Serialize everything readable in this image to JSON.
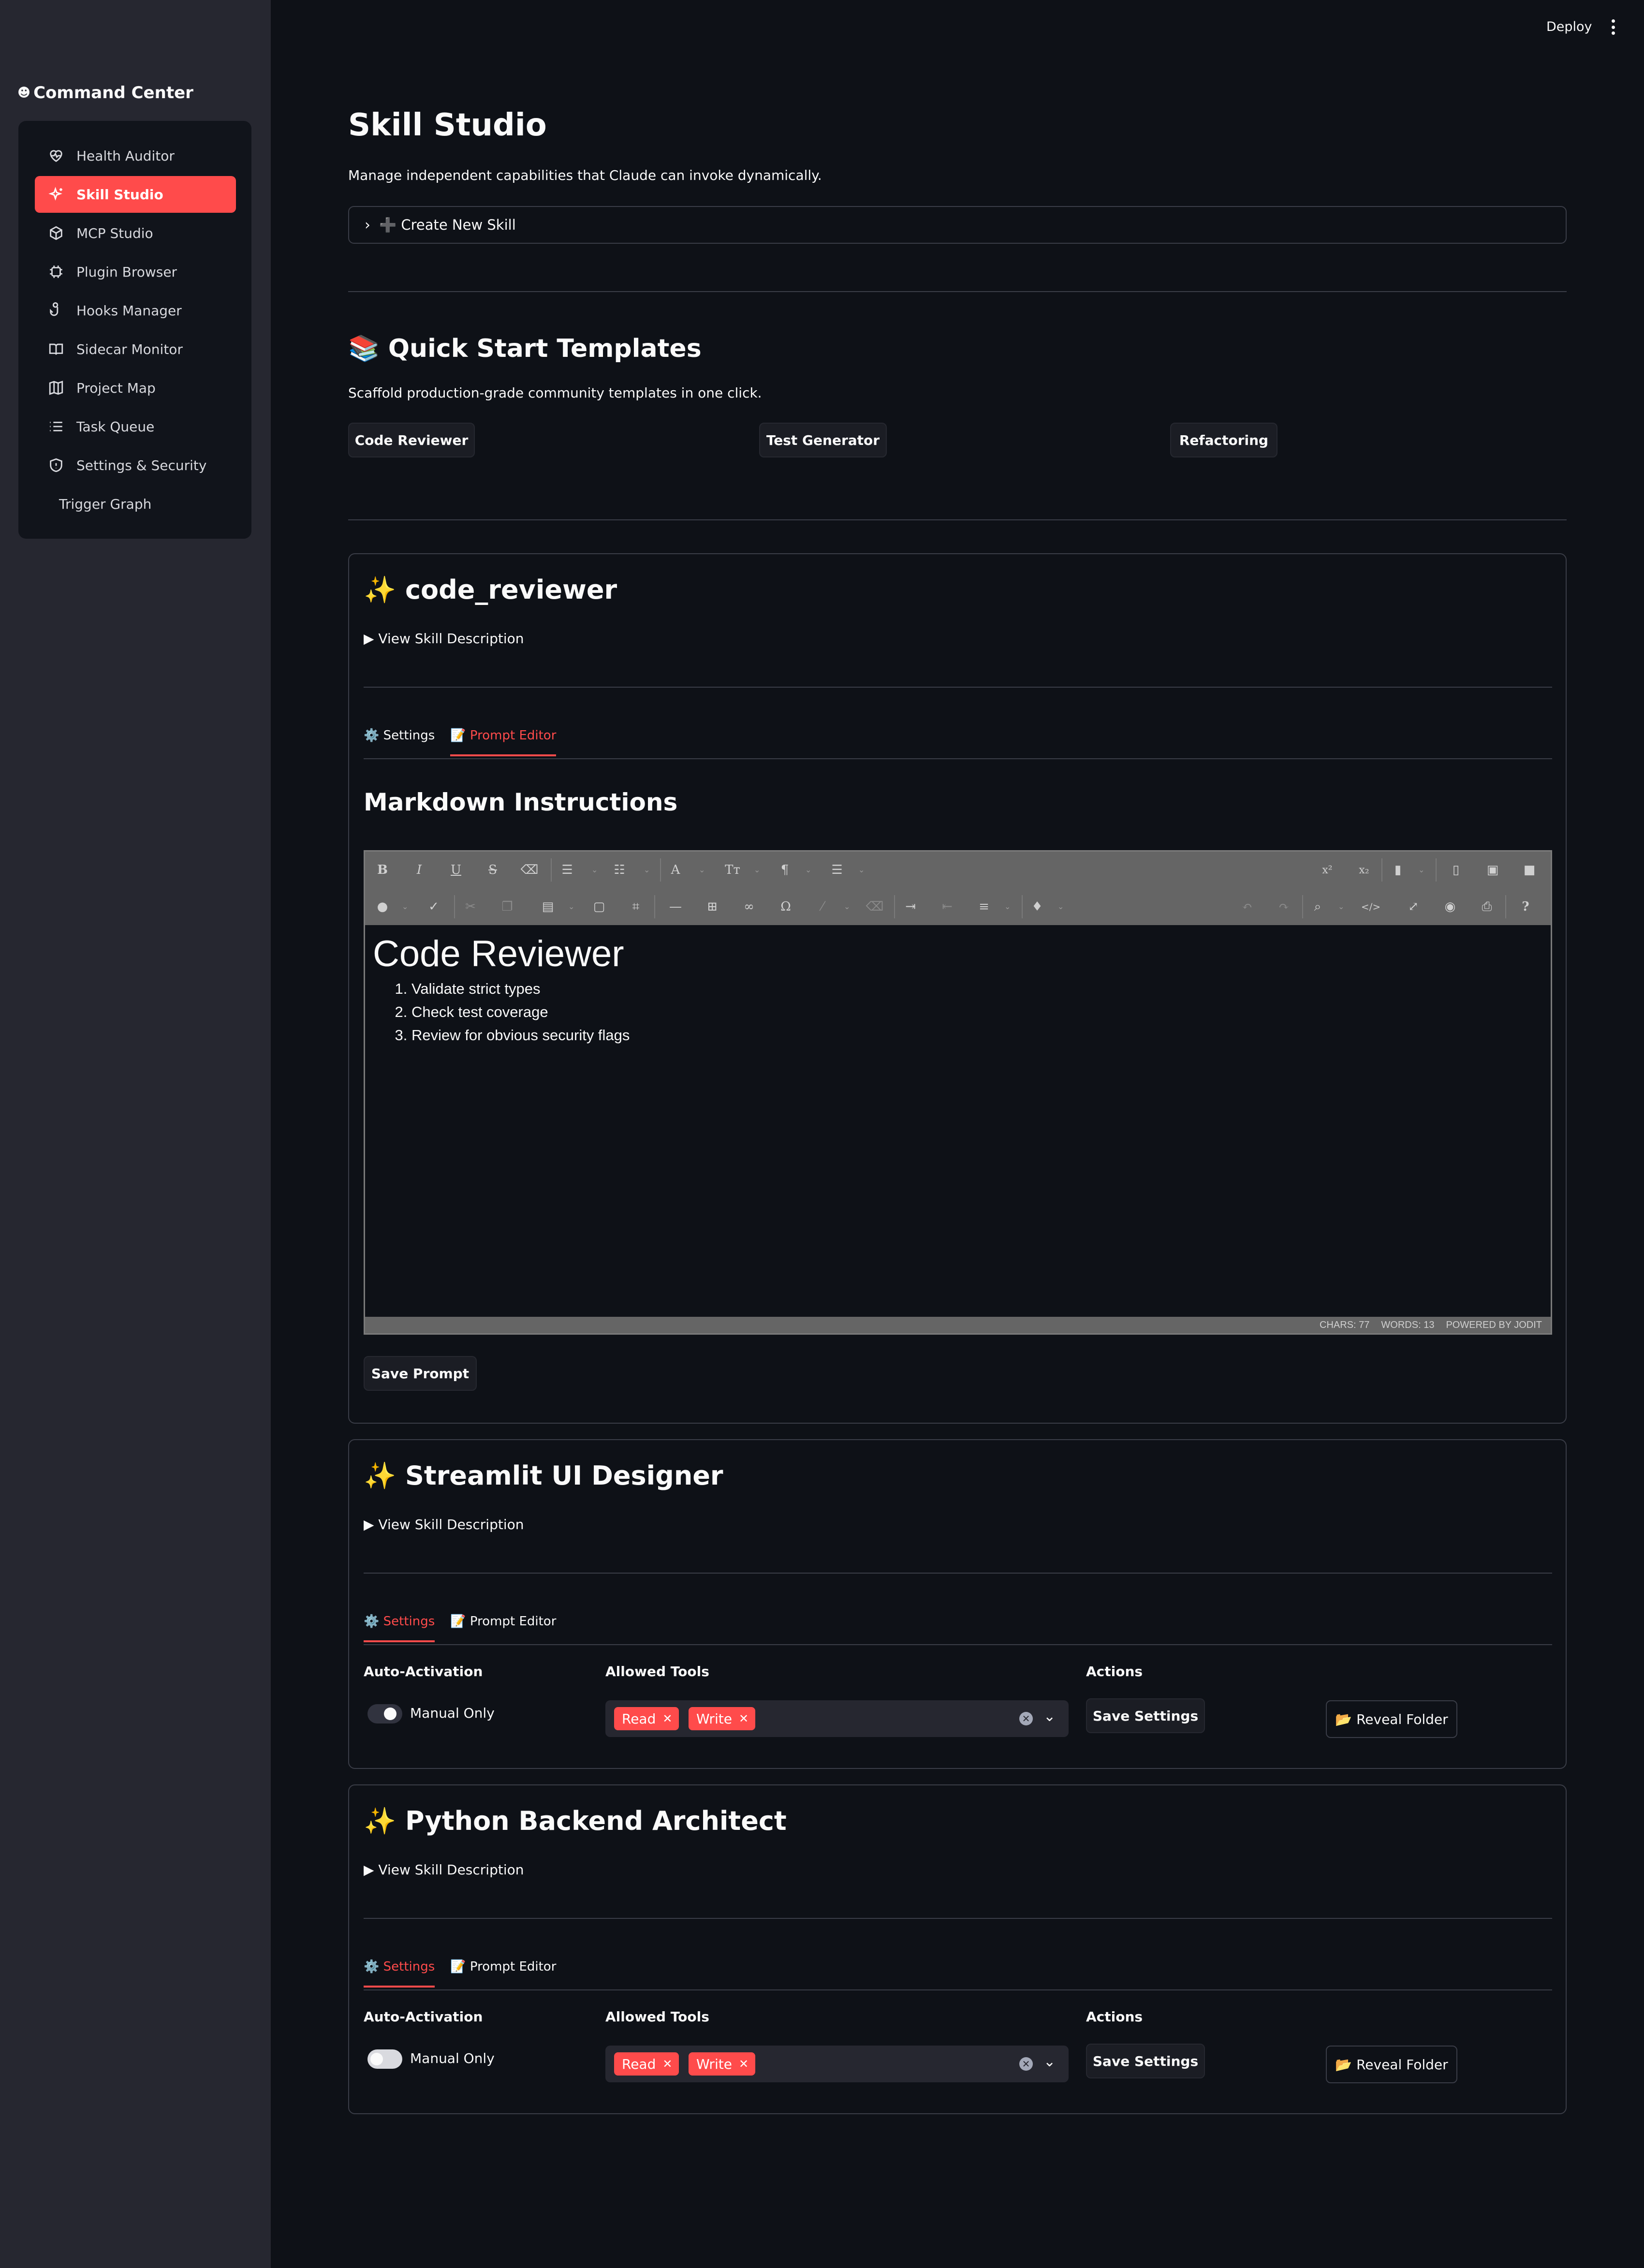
{
  "topbar": {
    "deploy_label": "Deploy"
  },
  "sidebar": {
    "brand": "Command Center",
    "brand_icon": "robot-icon",
    "items": [
      {
        "label": "Health Auditor",
        "icon": "heart-pulse-icon"
      },
      {
        "label": "Skill Studio",
        "icon": "sparkles-icon",
        "active": true
      },
      {
        "label": "MCP Studio",
        "icon": "cube-icon"
      },
      {
        "label": "Plugin Browser",
        "icon": "puzzle-icon"
      },
      {
        "label": "Hooks Manager",
        "icon": "hook-icon"
      },
      {
        "label": "Sidecar Monitor",
        "icon": "book-open-icon"
      },
      {
        "label": "Project Map",
        "icon": "map-icon"
      },
      {
        "label": "Task Queue",
        "icon": "list-icon"
      },
      {
        "label": "Settings & Security",
        "icon": "shield-icon"
      },
      {
        "label": "Trigger Graph",
        "icon": ""
      }
    ]
  },
  "page": {
    "title": "Skill Studio",
    "subtitle": "Manage independent capabilities that Claude can invoke dynamically.",
    "create_expander": "➕ Create New Skill"
  },
  "templates": {
    "title": "📚 Quick Start Templates",
    "description": "Scaffold production-grade community templates in one click.",
    "buttons": [
      "Code Reviewer",
      "Test Generator",
      "Refactoring"
    ]
  },
  "skills": [
    {
      "title": "✨ code_reviewer",
      "description_toggle": "▶ View Skill Description",
      "tabs": [
        "⚙️ Settings",
        "📝 Prompt Editor"
      ],
      "active_tab": 1,
      "editor": {
        "heading": "Markdown Instructions",
        "content_title": "Code Reviewer",
        "content_items": [
          "Validate strict types",
          "Check test coverage",
          "Review for obvious security flags"
        ],
        "status_chars": "CHARS: 77",
        "status_words": "WORDS: 13",
        "status_powered": "POWERED BY JODIT"
      },
      "save_label": "Save Prompt"
    },
    {
      "title": "✨ Streamlit UI Designer",
      "description_toggle": "▶ View Skill Description",
      "tabs": [
        "⚙️ Settings",
        "📝 Prompt Editor"
      ],
      "active_tab": 0,
      "settings": {
        "auto_label": "Auto-Activation",
        "toggle_label": "Manual Only",
        "tools_label": "Allowed Tools",
        "tools": [
          "Read",
          "Write"
        ],
        "actions_label": "Actions",
        "save_label": "Save Settings",
        "reveal_label": "📂 Reveal Folder"
      }
    },
    {
      "title": "✨ Python Backend Architect",
      "description_toggle": "▶ View Skill Description",
      "tabs": [
        "⚙️ Settings",
        "📝 Prompt Editor"
      ],
      "active_tab": 0,
      "settings": {
        "auto_label": "Auto-Activation",
        "toggle_label": "Manual Only",
        "tools_label": "Allowed Tools",
        "tools": [
          "Read",
          "Write"
        ],
        "actions_label": "Actions",
        "save_label": "Save Settings",
        "reveal_label": "📂 Reveal Folder"
      }
    }
  ],
  "colors": {
    "accent": "#ff4b4b",
    "background": "#0e1117",
    "sidebar": "#262730"
  }
}
